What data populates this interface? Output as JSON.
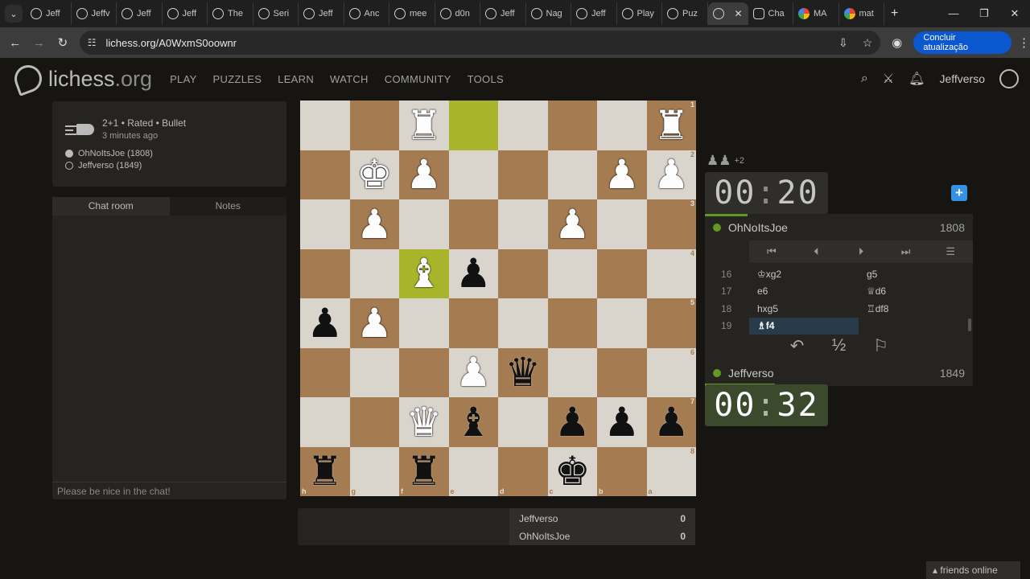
{
  "browser": {
    "tabs": [
      {
        "label": "Jeff",
        "icon": "lichess-icon"
      },
      {
        "label": "Jeffv",
        "icon": "lichess-icon"
      },
      {
        "label": "Jeff",
        "icon": "lichess-icon"
      },
      {
        "label": "Jeff",
        "icon": "lichess-icon"
      },
      {
        "label": "The",
        "icon": "lichess-icon"
      },
      {
        "label": "Seri",
        "icon": "lichess-icon"
      },
      {
        "label": "Jeff",
        "icon": "lichess-icon"
      },
      {
        "label": "Anc",
        "icon": "lichess-icon"
      },
      {
        "label": "mee",
        "icon": "lichess-icon"
      },
      {
        "label": "d0n",
        "icon": "lichess-icon"
      },
      {
        "label": "Jeff",
        "icon": "lichess-icon"
      },
      {
        "label": "Nag",
        "icon": "lichess-icon"
      },
      {
        "label": "Jeff",
        "icon": "lichess-icon"
      },
      {
        "label": "Play",
        "icon": "lichess-icon"
      },
      {
        "label": "Puz",
        "icon": "lichess-icon"
      },
      {
        "label": "",
        "icon": "lichess-icon",
        "active": true
      },
      {
        "label": "Cha",
        "icon": "chatgpt-icon"
      },
      {
        "label": "MA",
        "icon": "google-icon"
      },
      {
        "label": "mat",
        "icon": "google-icon"
      }
    ],
    "url": "lichess.org/A0WxmS0oownr",
    "update_button": "Concluir atualização"
  },
  "site": {
    "logo_main": "lichess",
    "logo_org": ".org",
    "nav": [
      "PLAY",
      "PUZZLES",
      "LEARN",
      "WATCH",
      "COMMUNITY",
      "TOOLS"
    ],
    "username": "Jeffverso"
  },
  "game_info": {
    "mode": "2+1 • Rated • Bullet",
    "time_ago": "3 minutes ago",
    "white_player": "OhNoItsJoe (1808)",
    "black_player": "Jeffverso (1849)"
  },
  "chat": {
    "tabs": [
      "Chat room",
      "Notes"
    ],
    "input_placeholder": "Please be nice in the chat!"
  },
  "board": {
    "orientation": "black",
    "highlight_squares": [
      "e1",
      "f4"
    ],
    "ranks": [
      [
        "",
        "",
        "R",
        "",
        "",
        "",
        "",
        "R"
      ],
      [
        "",
        "K",
        "P",
        "",
        "",
        "",
        "P",
        "P"
      ],
      [
        "",
        "P",
        "",
        "",
        "",
        "P",
        "",
        ""
      ],
      [
        "",
        "",
        "B",
        "p",
        "",
        "",
        "",
        ""
      ],
      [
        "p",
        "P",
        "",
        "",
        "",
        "",
        "",
        ""
      ],
      [
        "",
        "",
        "",
        "P",
        "q",
        "",
        "",
        ""
      ],
      [
        "",
        "",
        "Q",
        "b",
        "",
        "p",
        "p",
        "p"
      ],
      [
        "r",
        "",
        "r",
        "",
        "",
        "k",
        "",
        ""
      ]
    ],
    "rank_labels": [
      "1",
      "2",
      "3",
      "4",
      "5",
      "6",
      "7",
      "8"
    ],
    "file_labels": [
      "h",
      "g",
      "f",
      "e",
      "d",
      "c",
      "b",
      "a"
    ]
  },
  "scoreboard": [
    {
      "name": "Jeffverso",
      "score": "0"
    },
    {
      "name": "OhNoItsJoe",
      "score": "0"
    }
  ],
  "material": {
    "diff": "+2"
  },
  "clocks": {
    "top": {
      "min": "00",
      "sec": "20",
      "progress_pct": 16
    },
    "bottom": {
      "min": "00",
      "sec": "32",
      "progress_pct": 26
    }
  },
  "players": {
    "top": {
      "name": "OhNoItsJoe",
      "rating": "1808"
    },
    "bottom": {
      "name": "Jeffverso",
      "rating": "1849"
    }
  },
  "moves": [
    {
      "n": "16",
      "w": "♔xg2",
      "b": "g5"
    },
    {
      "n": "17",
      "w": "e6",
      "b": "♕d6"
    },
    {
      "n": "18",
      "w": "hxg5",
      "b": "♖df8"
    },
    {
      "n": "19",
      "w": "♗f4",
      "b": "",
      "current": true
    }
  ],
  "footer": {
    "friends": "friends online"
  },
  "colors": {
    "accent": "#629924",
    "board_light": "#d9d4cc",
    "board_dark": "#a57c52",
    "highlight": "#c9d24a"
  }
}
